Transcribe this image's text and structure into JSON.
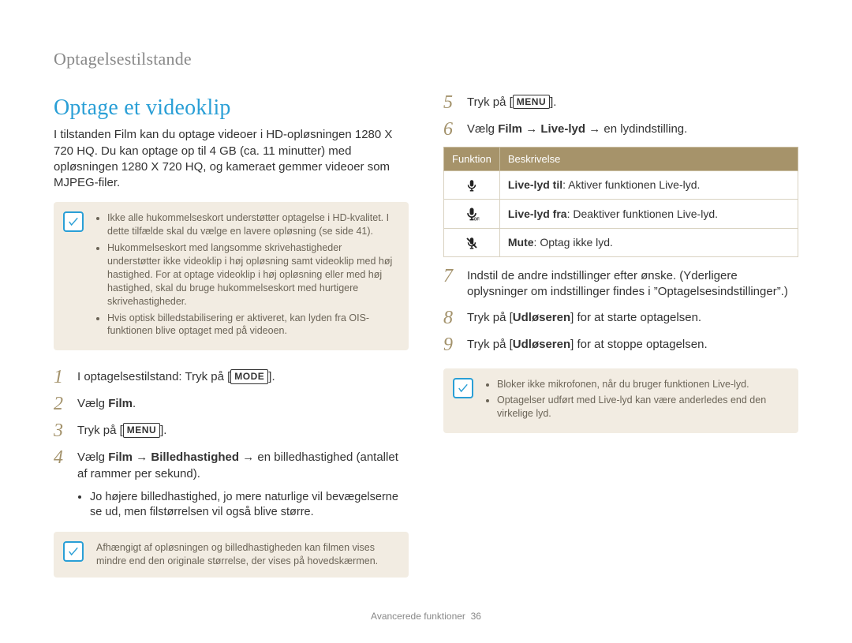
{
  "breadcrumb": "Optagelsestilstande",
  "title": "Optage et videoklip",
  "intro": "I tilstanden Film kan du optage videoer i HD-opløsningen 1280 X 720 HQ. Du kan optage op til 4 GB (ca. 11 minutter) med opløsningen 1280 X 720 HQ, og kameraet gemmer videoer som MJPEG-filer.",
  "note1": {
    "items": [
      "Ikke alle hukommelseskort understøtter optagelse i HD-kvalitet. I dette tilfælde skal du vælge en lavere opløsning (se side 41).",
      "Hukommelseskort med langsomme skrivehastigheder understøtter ikke videoklip i høj opløsning samt videoklip med høj hastighed. For at optage videoklip i høj opløsning eller med høj hastighed, skal du bruge hukommelseskort med hurtigere skrivehastigheder.",
      "Hvis optisk billedstabilisering er aktiveret, kan lyden fra OIS-funktionen blive optaget med på videoen."
    ]
  },
  "steps_left": {
    "1": {
      "prefix": "I optagelsestilstand: Tryk på [",
      "button": "MODE",
      "suffix": "]."
    },
    "2": {
      "prefix": "Vælg ",
      "bold": "Film",
      "suffix": "."
    },
    "3": {
      "prefix": "Tryk på [",
      "button": "MENU",
      "suffix": "]."
    },
    "4": {
      "prefix": "Vælg ",
      "b1": "Film",
      "arrow1": " → ",
      "b2": "Billedhastighed",
      "arrow2": " → en billedhastighed (antallet af rammer per sekund).",
      "bullet": "Jo højere billedhastighed, jo mere naturlige vil bevægelserne se ud, men filstørrelsen vil også blive større."
    }
  },
  "note2": "Afhængigt af opløsningen og billedhastigheden kan filmen vises mindre end den originale størrelse, der vises på hovedskærmen.",
  "steps_right": {
    "5": {
      "prefix": "Tryk på [",
      "button": "MENU",
      "suffix": "]."
    },
    "6": {
      "prefix": "Vælg ",
      "b1": "Film",
      "arrow1": " → ",
      "b2": "Live-lyd",
      "arrow2": " → en lydindstilling."
    },
    "7": "Indstil de andre indstillinger efter  ønske. (Yderligere oplysninger om indstillinger findes i ”Optagelsesindstillinger”.)",
    "8": {
      "prefix": "Tryk på [",
      "bold": "Udløseren",
      "suffix": "] for at starte optagelsen."
    },
    "9": {
      "prefix": "Tryk på [",
      "bold": "Udløseren",
      "suffix": "] for at stoppe optagelsen."
    }
  },
  "table": {
    "headers": {
      "function": "Funktion",
      "desc": "Beskrivelse"
    },
    "rows": [
      {
        "icon": "mic-on",
        "label": "Live-lyd til",
        "desc": ": Aktiver funktionen Live-lyd."
      },
      {
        "icon": "mic-off",
        "label": "Live-lyd fra",
        "desc": ": Deaktiver funktionen Live-lyd."
      },
      {
        "icon": "mic-mute",
        "label": "Mute",
        "desc": ": Optag ikke lyd."
      }
    ]
  },
  "note3": {
    "items": [
      "Bloker ikke mikrofonen, når du bruger funktionen Live-lyd.",
      "Optagelser udført med Live-lyd kan være anderledes end den virkelige lyd."
    ]
  },
  "footer": {
    "section": "Avancerede funktioner",
    "page": "36"
  }
}
